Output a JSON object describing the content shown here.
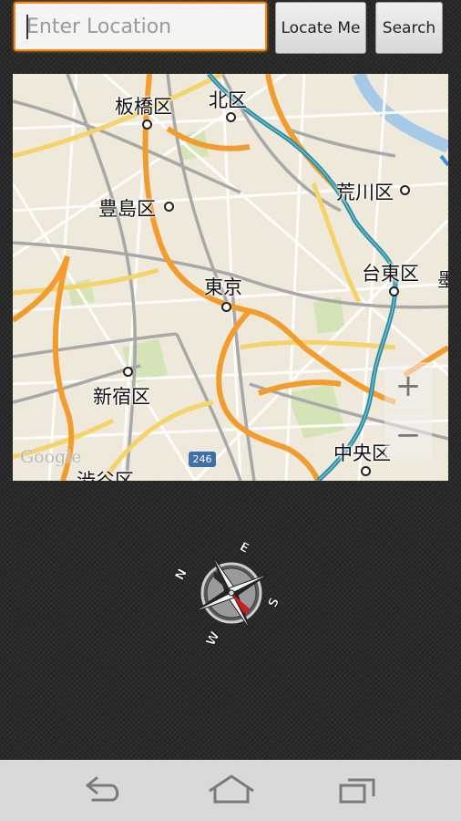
{
  "search": {
    "placeholder": "Enter Location",
    "locate_label": "Locate Me",
    "search_label": "Search"
  },
  "map": {
    "labels": {
      "itabashi": "板橋区",
      "kita": "北区",
      "arakawa": "荒川区",
      "toshima": "豊島区",
      "taito": "台東区",
      "tokyo": "東京",
      "shinjuku": "新宿区",
      "chuo": "中央区",
      "shibuya": "渋谷区",
      "edge": "墨"
    },
    "route_number": "246",
    "attribution": "Google",
    "zoom_in_label": "+",
    "zoom_out_label": "−"
  },
  "compass": {
    "north": "N",
    "east": "E",
    "south": "S",
    "west": "W"
  },
  "navbar": {
    "back_icon": "back-arrow-icon",
    "home_icon": "home-icon",
    "recents_icon": "recent-apps-icon"
  },
  "colors": {
    "accent": "#f08a1c",
    "background": "#2a2a2a",
    "navbar": "#d9d9d9",
    "rail": "#2c8fa6"
  }
}
